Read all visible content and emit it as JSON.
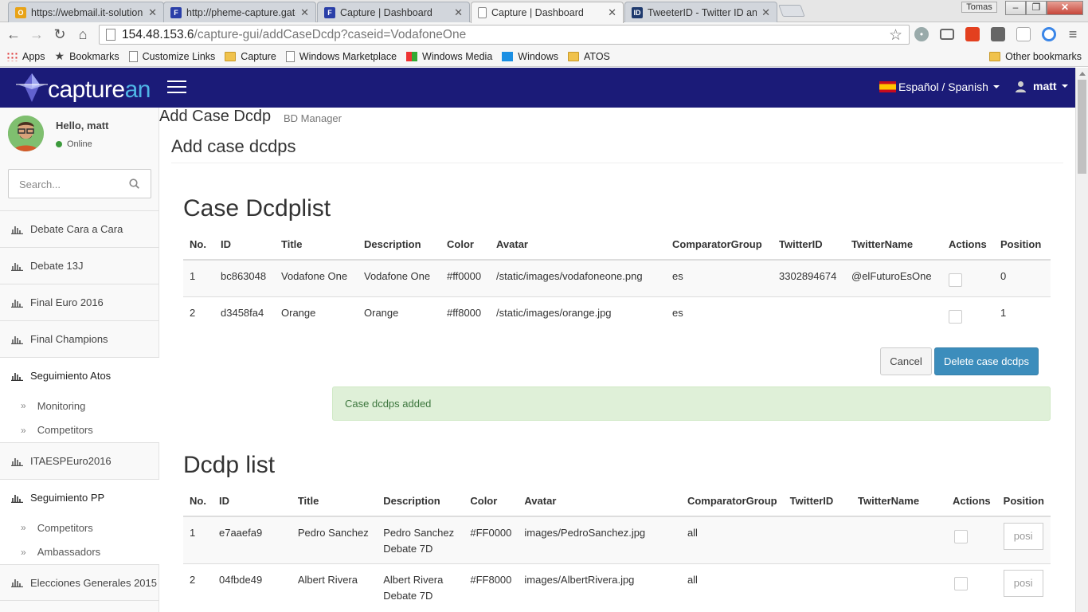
{
  "browser": {
    "tabs": [
      {
        "title": "https://webmail.it-solution",
        "fav_color": "#e8a317",
        "fav_text": "O"
      },
      {
        "title": "http://pheme-capture.gate",
        "fav_color": "#2a3fa8",
        "fav_text": "F"
      },
      {
        "title": "Capture | Dashboard",
        "fav_color": "#2a3fa8",
        "fav_text": "F"
      },
      {
        "title": "Capture | Dashboard",
        "fav_color": "#ffffff",
        "fav_text": ""
      },
      {
        "title": "TweeterID - Twitter ID and",
        "fav_color": "#1f3a6e",
        "fav_text": "ID"
      }
    ],
    "profile_name": "Tomas",
    "url_host": "154.48.153.6",
    "url_path": "/capture-gui/addCaseDcdp?caseid=VodafoneOne",
    "bookmarks": [
      "Apps",
      "Bookmarks",
      "Customize Links",
      "Capture",
      "Windows Marketplace",
      "Windows Media",
      "Windows",
      "ATOS"
    ],
    "other_bookmarks": "Other bookmarks"
  },
  "header": {
    "logo_a": "capture",
    "logo_b": "an",
    "language": "Español / Spanish",
    "user": "matt"
  },
  "sidebar": {
    "hello": "Hello, matt",
    "status": "Online",
    "search_placeholder": "Search...",
    "items": [
      {
        "label": "Debate Cara a Cara"
      },
      {
        "label": "Debate 13J"
      },
      {
        "label": "Final Euro 2016"
      },
      {
        "label": "Final Champions"
      },
      {
        "label": "Seguimiento Atos",
        "subs": [
          "Monitoring",
          "Competitors"
        ]
      },
      {
        "label": "ITAESPEuro2016"
      },
      {
        "label": "Seguimiento PP",
        "subs": [
          "Competitors",
          "Ambassadors"
        ]
      },
      {
        "label": "Elecciones Generales 2015"
      }
    ]
  },
  "main": {
    "page_title": "Add Case Dcdp",
    "page_subtitle": "BD Manager",
    "box_title": "Add case dcdps",
    "case_list": {
      "title": "Case Dcdplist",
      "headers": [
        "No.",
        "ID",
        "Title",
        "Description",
        "Color",
        "Avatar",
        "ComparatorGroup",
        "TwitterID",
        "TwitterName",
        "Actions",
        "Position"
      ],
      "rows": [
        [
          "1",
          "bc863048",
          "Vodafone One",
          "Vodafone One",
          "#ff0000",
          "/static/images/vodafoneone.png",
          "es",
          "3302894674",
          "@elFuturoEsOne",
          "",
          "0"
        ],
        [
          "2",
          "d3458fa4",
          "Orange",
          "Orange",
          "#ff8000",
          "/static/images/orange.jpg",
          "es",
          "",
          "",
          "",
          "1"
        ]
      ],
      "cancel_label": "Cancel",
      "delete_label": "Delete case dcdps"
    },
    "alert": "Case dcdps added",
    "dcdp_list": {
      "title": "Dcdp list",
      "headers": [
        "No.",
        "ID",
        "Title",
        "Description",
        "Color",
        "Avatar",
        "ComparatorGroup",
        "TwitterID",
        "TwitterName",
        "Actions",
        "Position"
      ],
      "rows": [
        [
          "1",
          "e7aaefa9",
          "Pedro Sanchez",
          "Pedro Sanchez Debate 7D",
          "#FF0000",
          "images/PedroSanchez.jpg",
          "all",
          "",
          "",
          "",
          ""
        ],
        [
          "2",
          "04fbde49",
          "Albert Rivera",
          "Albert Rivera Debate 7D",
          "#FF8000",
          "images/AlbertRivera.jpg",
          "all",
          "",
          "",
          "",
          ""
        ]
      ],
      "position_placeholder": "posi"
    }
  }
}
